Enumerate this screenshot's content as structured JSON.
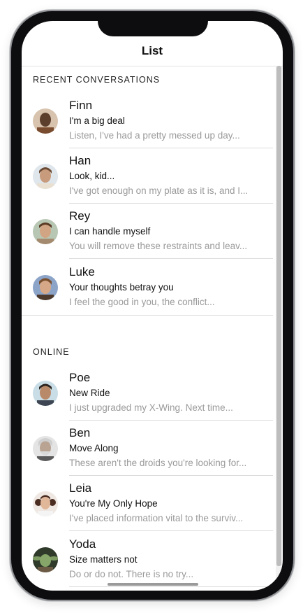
{
  "header": {
    "title": "List"
  },
  "sections": [
    {
      "title": "RECENT CONVERSATIONS",
      "items": [
        {
          "name": "Finn",
          "subtitle": "I'm a big deal",
          "preview": "Listen, I've had a pretty messed up day...",
          "avatar_color": "#8a6a55"
        },
        {
          "name": "Han",
          "subtitle": "Look, kid...",
          "preview": "I've got enough on my plate as it is, and I...",
          "avatar_color": "#a98a6c"
        },
        {
          "name": "Rey",
          "subtitle": "I can handle myself",
          "preview": "You will remove these restraints and leav...",
          "avatar_color": "#9a7f65"
        },
        {
          "name": "Luke",
          "subtitle": "Your thoughts betray you",
          "preview": "I feel the good in you, the conflict...",
          "avatar_color": "#6d7f9e"
        }
      ]
    },
    {
      "title": "ONLINE",
      "items": [
        {
          "name": "Poe",
          "subtitle": "New Ride",
          "preview": "I just upgraded my X-Wing. Next time...",
          "avatar_color": "#6f6c6a"
        },
        {
          "name": "Ben",
          "subtitle": "Move Along",
          "preview": "These aren't the droids you're looking for...",
          "avatar_color": "#8a8a8a"
        },
        {
          "name": "Leia",
          "subtitle": "You're My Only Hope",
          "preview": "I've placed information vital to the surviv...",
          "avatar_color": "#6b4a3f"
        },
        {
          "name": "Yoda",
          "subtitle": "Size matters not",
          "preview": "Do or do not. There is no try...",
          "avatar_color": "#4f6a45"
        }
      ]
    }
  ]
}
